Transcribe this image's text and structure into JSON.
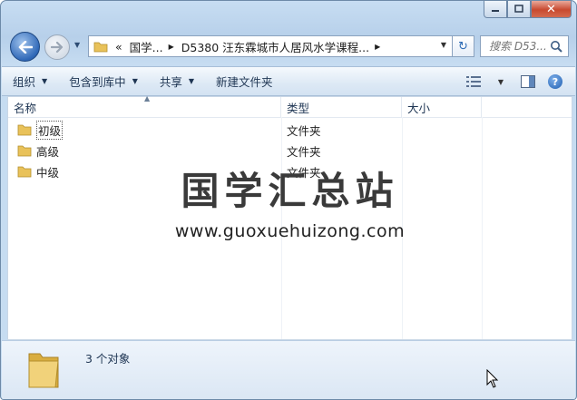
{
  "window": {
    "caption": {
      "minimize": "▭",
      "maximize": "□",
      "close": "✕"
    }
  },
  "nav": {
    "back_glyph": "⬅",
    "forward_glyph": "➡",
    "breadcrumb_root": "«",
    "breadcrumb_1": "国学...",
    "breadcrumb_2": "D5380 汪东霖城市人居风水学课程...",
    "search_placeholder": "搜索 D53...",
    "refresh_glyph": "↻"
  },
  "toolbar": {
    "organize": "组织",
    "include_in_library": "包含到库中",
    "share": "共享",
    "new_folder": "新建文件夹"
  },
  "columns": {
    "name": "名称",
    "type": "类型",
    "size": "大小"
  },
  "files": [
    {
      "name": "初级",
      "type": "文件夹",
      "size": ""
    },
    {
      "name": "高级",
      "type": "文件夹",
      "size": ""
    },
    {
      "name": "中级",
      "type": "文件夹",
      "size": ""
    }
  ],
  "watermark": {
    "title": "国学汇总站",
    "url": "www.guoxuehuizong.com"
  },
  "status": {
    "count_text": "3 个对象"
  },
  "colors": {
    "accent": "#3069b8",
    "folder": "#e9c25a"
  }
}
